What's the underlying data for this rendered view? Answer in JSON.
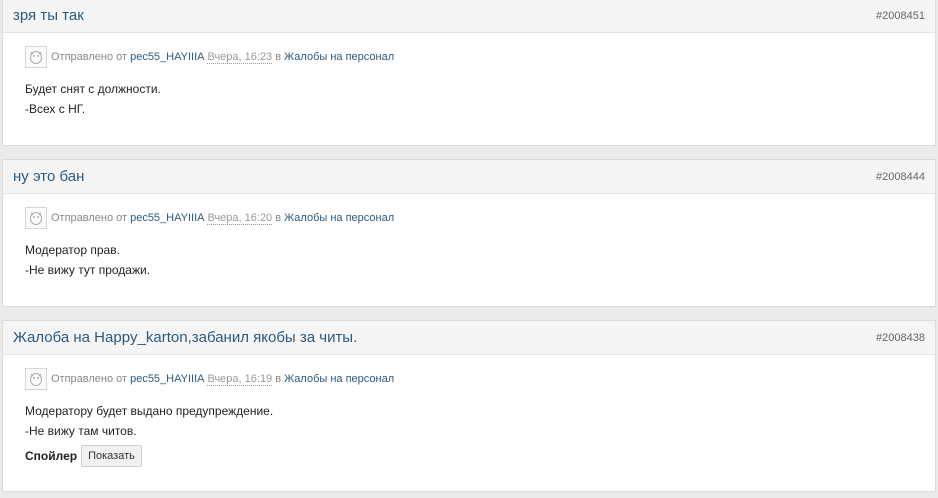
{
  "posts": [
    {
      "title": "зря ты так",
      "id": "#2008451",
      "sent_by": "Отправлено от",
      "author": "pec55_HAYIIIA",
      "date": "Вчера, 16:23",
      "in": "в",
      "forum": "Жалобы на персонал",
      "lines": [
        "Будет снят с должности.",
        "-Всех с НГ."
      ]
    },
    {
      "title": "ну это бан",
      "id": "#2008444",
      "sent_by": "Отправлено от",
      "author": "pec55_HAYIIIA",
      "date": "Вчера, 16:20",
      "in": "в",
      "forum": "Жалобы на персонал",
      "lines": [
        "Модератор прав.",
        "-Не вижу тут продажи."
      ]
    },
    {
      "title": "Жалоба на Happy_karton,забанил якобы за читы.",
      "id": "#2008438",
      "sent_by": "Отправлено от",
      "author": "pec55_HAYIIIA",
      "date": "Вчера, 16:19",
      "in": "в",
      "forum": "Жалобы на персонал",
      "lines": [
        "Модератору будет выдано предупреждение.",
        "-Не вижу там читов."
      ],
      "spoiler": {
        "label": "Спойлер",
        "button": "Показать"
      }
    }
  ]
}
